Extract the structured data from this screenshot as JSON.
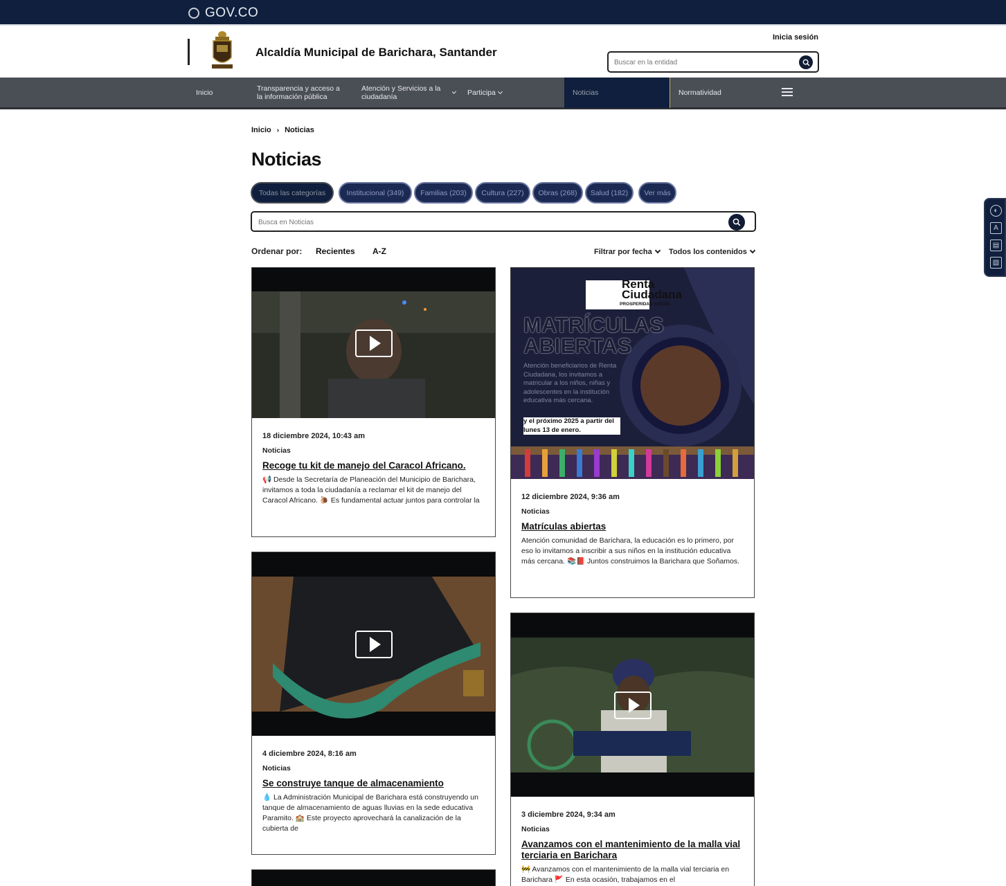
{
  "gov_bar": {
    "brand": "GOV.CO"
  },
  "header": {
    "entity_name": "Alcaldía Municipal de Barichara, Santander",
    "login_label": "Inicia sesión",
    "search_placeholder": "Buscar en la entidad"
  },
  "nav": {
    "items": [
      {
        "label": "Inicio"
      },
      {
        "label": "Transparencia y acceso a la información pública"
      },
      {
        "label": "Atención y Servicios a la ciudadanía"
      },
      {
        "label": "Participa"
      },
      {
        "label": "Noticias"
      },
      {
        "label": "Normatividad"
      }
    ]
  },
  "breadcrumb": {
    "home": "Inicio",
    "separator": "›",
    "current": "Noticias"
  },
  "page_title": "Noticias",
  "filters": {
    "chips": [
      {
        "label": "Todas las categorías"
      },
      {
        "label": "Institucional (349)"
      },
      {
        "label": "Familias (203)"
      },
      {
        "label": "Cultura (227)"
      },
      {
        "label": "Obras (268)"
      },
      {
        "label": "Salud (182)"
      },
      {
        "label": "Ver más"
      }
    ],
    "search_placeholder": "Busca en Noticias"
  },
  "sort": {
    "label": "Ordenar por:",
    "options": [
      "Recientes",
      "A-Z"
    ],
    "date_filter": "Filtrar por fecha",
    "content_filter": "Todos los contenidos"
  },
  "cards": [
    {
      "date": "18 diciembre 2024, 10:43 am",
      "category": "Noticias",
      "title": "Recoge tu kit de manejo del Caracol Africano.",
      "summary": "📢 Desde la Secretaría de Planeación del Municipio de Barichara, invitamos a toda la ciudadanía a reclamar el kit de manejo del Caracol Africano. 🐌 Es fundamental actuar juntos para controlar la",
      "media": "video"
    },
    {
      "date": "12 diciembre 2024, 9:36 am",
      "category": "Noticias",
      "title": "Matrículas abiertas",
      "summary": "Atención comunidad de Barichara, la educación es lo primero, por eso lo invitamos a inscribir a sus niños en la institución educativa más cercana. 📚📕 Juntos construimos la Barichara que Soñamos.",
      "media": "image",
      "poster": {
        "brand": "Renta Ciudadana",
        "brand_sub": "PROSPERIDAD SOCIAL",
        "headline": "MATRÍCULAS ABIERTAS",
        "text": "Atención beneficiarios de Renta Ciudadana, los invitamos a matricular a los niños, niñas y adolescentes en la institución educativa más cercana.",
        "text_bold": "y el próximo 2025 a partir del lunes 13 de enero."
      }
    },
    {
      "date": "4 diciembre 2024, 8:16 am",
      "category": "Noticias",
      "title": "Se construye tanque de almacenamiento",
      "summary": "💧 La Administración Municipal de Barichara está construyendo un tanque de almacenamiento de aguas lluvias en la sede educativa Paramito. 🏫 Este proyecto aprovechará la canalización de la cubierta de",
      "media": "video"
    },
    {
      "date": "3 diciembre 2024, 9:34 am",
      "category": "Noticias",
      "title": "Avanzamos con el mantenimiento de la malla vial terciaria en Barichara",
      "summary": "🚧 Avanzamos con el mantenimiento de la malla vial terciaria en Barichara 🚩 En esta ocasión, trabajamos en el",
      "media": "video"
    }
  ],
  "colors": {
    "navy": "#0f1f3d",
    "nav_gray": "#4a4e55",
    "chip_bg": "#1b2a52",
    "accent_gold": "#c9b35a"
  },
  "icons": {
    "search": "search-icon",
    "menu": "hamburger-menu-icon",
    "play": "play-icon",
    "a11y": [
      "contrast-icon",
      "font-size-icon",
      "image-toggle-icon",
      "reader-icon"
    ]
  }
}
